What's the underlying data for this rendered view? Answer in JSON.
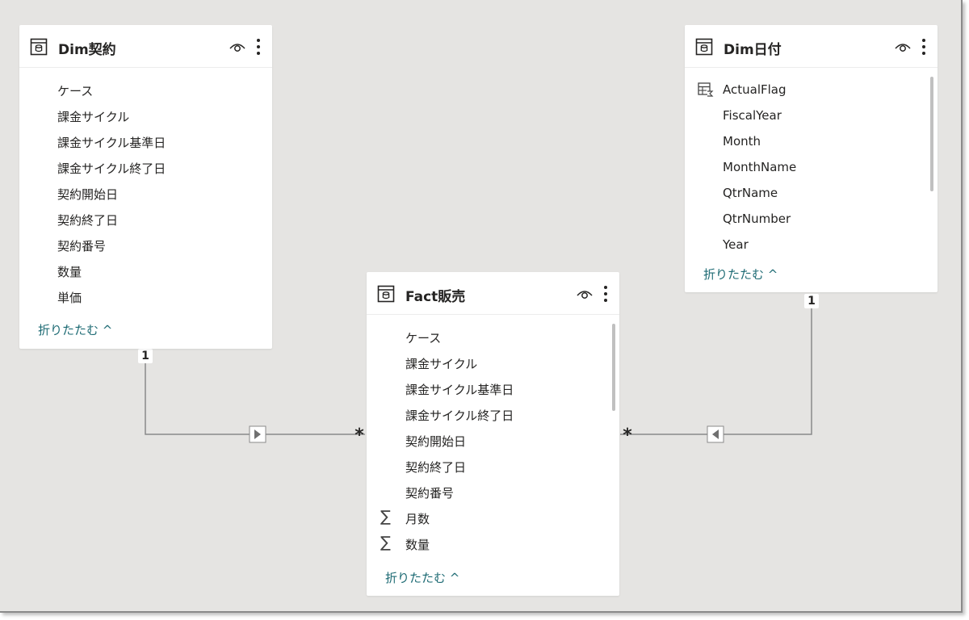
{
  "tables": {
    "dim_contract": {
      "title": "Dim契約",
      "fields": [
        "ケース",
        "課金サイクル",
        "課金サイクル基準日",
        "課金サイクル終了日",
        "契約開始日",
        "契約終了日",
        "契約番号",
        "数量",
        "単価"
      ],
      "collapse_label": "折りたたむ ^"
    },
    "fact_sales": {
      "title": "Fact販売",
      "fields": [
        "ケース",
        "課金サイクル",
        "課金サイクル基準日",
        "課金サイクル終了日",
        "契約開始日",
        "契約終了日",
        "契約番号",
        "月数",
        "数量"
      ],
      "field_icons": [
        "",
        "",
        "",
        "",
        "",
        "",
        "",
        "sigma",
        "sigma"
      ],
      "collapse_label": "折りたたむ ^"
    },
    "dim_date": {
      "title": "Dim日付",
      "fields": [
        "ActualFlag",
        "FiscalYear",
        "Month",
        "MonthName",
        "QtrName",
        "QtrNumber",
        "Year"
      ],
      "field_icons": [
        "calculated-table-icon",
        "",
        "",
        "",
        "",
        "",
        ""
      ],
      "collapse_label": "折りたたむ ^"
    }
  },
  "relationships": {
    "contract_to_sales": {
      "one_side": "1",
      "many_side": "*",
      "direction": "right-arrow"
    },
    "date_to_sales": {
      "one_side": "1",
      "many_side": "*",
      "direction": "left-arrow"
    }
  },
  "icons": {
    "sigma_glyph": "∑",
    "table_icon": "table-icon",
    "visibility_icon": "eye-icon",
    "more_icon": "more-options-icon"
  },
  "colors": {
    "canvas": "#e5e4e2",
    "card": "#ffffff",
    "link_text": "#1e6b74",
    "connector": "#8a8a8a"
  }
}
